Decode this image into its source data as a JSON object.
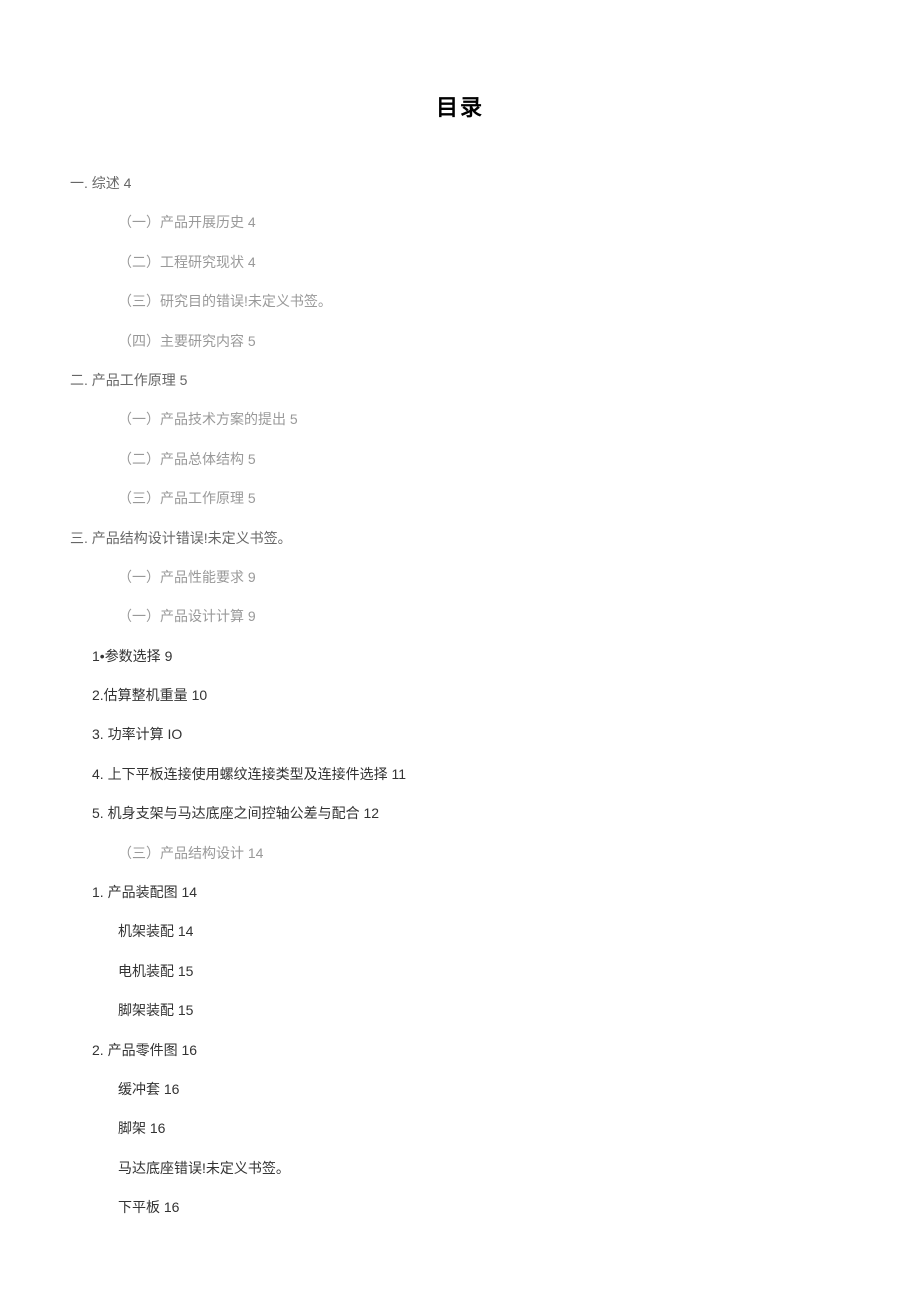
{
  "title": "目录",
  "toc": {
    "section1": {
      "heading": "一. 综述 4",
      "items": [
        "（一）产品开展历史 4",
        "（二）工程研究现状 4",
        "（三）研究目的错误!未定义书签。",
        "（四）主要研究内容 5"
      ]
    },
    "section2": {
      "heading": "二. 产品工作原理 5",
      "items": [
        "（一）产品技术方案的提出 5",
        "（二）产品总体结构 5",
        "（三）产品工作原理 5"
      ]
    },
    "section3": {
      "heading": "三. 产品结构设计错误!未定义书签。",
      "items_a": [
        "（一）产品性能要求 9",
        "（一）产品设计计算 9"
      ],
      "numbered": [
        "1•参数选择 9",
        "2.估算整机重量 10",
        "3. 功率计算 IO",
        "4. 上下平板连接使用螺纹连接类型及连接件选择 11",
        "5. 机身支架与马达底座之间控轴公差与配合 12"
      ],
      "items_b": [
        "（三）产品结构设计 14"
      ],
      "sub1": {
        "heading": "1. 产品装配图 14",
        "items": [
          "机架装配 14",
          "电机装配 15",
          "脚架装配 15"
        ]
      },
      "sub2": {
        "heading": "2. 产品零件图 16",
        "items": [
          "缓冲套 16",
          "脚架 16",
          "马达底座错误!未定义书签。",
          "下平板 16"
        ]
      }
    }
  }
}
